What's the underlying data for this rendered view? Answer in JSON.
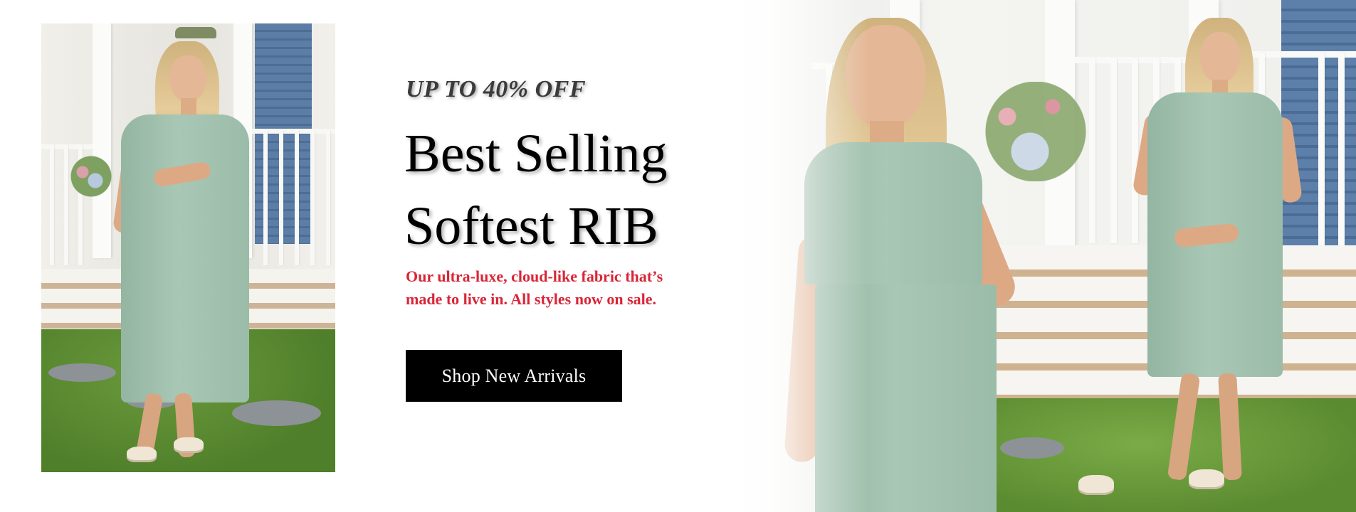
{
  "banner": {
    "promo": "UP TO 40% OFF",
    "headline_line1": "Best Selling",
    "headline_line2": "Softest RIB",
    "description_line1": "Our ultra-luxe, cloud-like fabric that’s",
    "description_line2": "made to live in. All styles now on sale.",
    "cta_label": "Shop New Arrivals"
  },
  "colors": {
    "cta_background": "#000000",
    "cta_text": "#ffffff",
    "description": "#d92536",
    "promo": "#3b3b3b",
    "dress": "#a3c2b0"
  }
}
